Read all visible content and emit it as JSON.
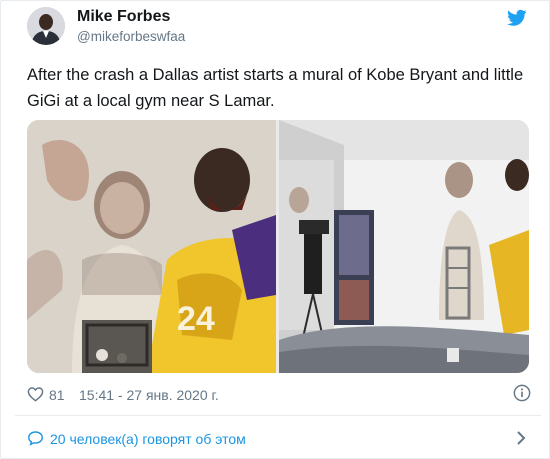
{
  "author": {
    "name": "Mike Forbes",
    "handle": "@mikeforbeswfaa"
  },
  "tweet": {
    "text": "After the crash a Dallas artist starts a mural of Kobe Bryant and little GiGi at a local gym near S Lamar."
  },
  "media": {
    "photo_count": 2
  },
  "meta": {
    "like_count": "81",
    "timestamp": "15:41 - 27 янв. 2020 г."
  },
  "footer": {
    "discussion_text": "20 человек(а) говорят об этом"
  },
  "icons": {
    "logo": "twitter-bird-icon",
    "like": "heart-icon",
    "info": "info-icon",
    "discussion": "chat-bubble-icon",
    "more": "chevron-right-icon"
  },
  "colors": {
    "brand": "#1da1f2",
    "link": "#1b95e0",
    "muted": "#657786",
    "text": "#14171a",
    "border": "#e6ecf0"
  }
}
